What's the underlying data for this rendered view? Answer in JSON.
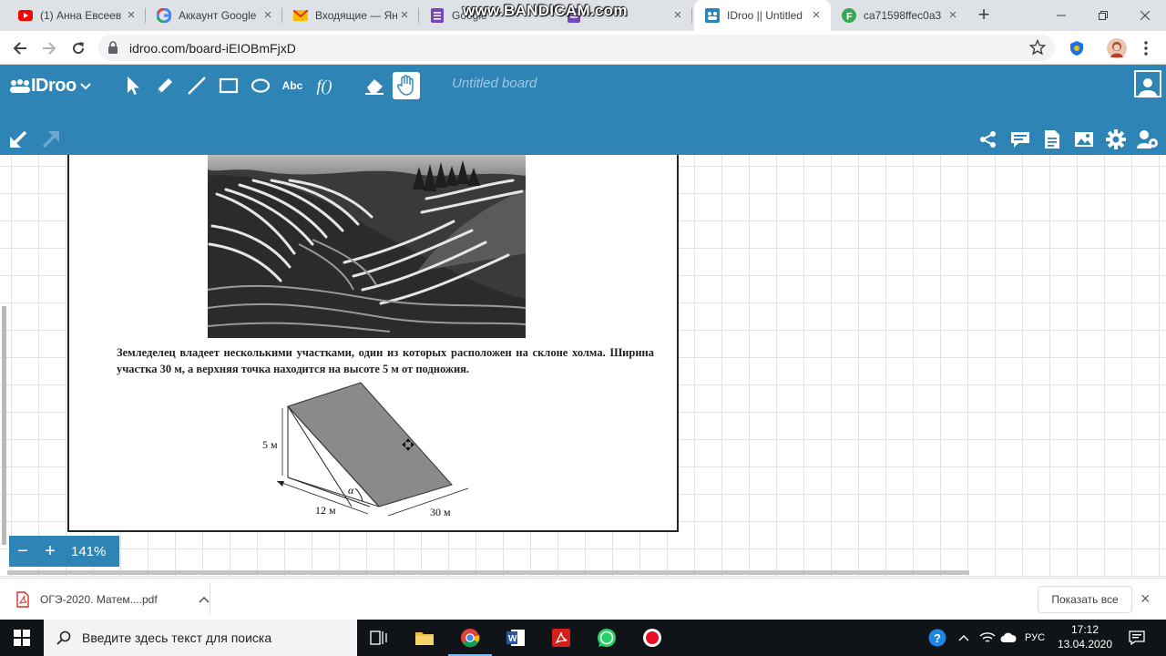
{
  "browser": {
    "tabs": [
      {
        "title": "(1) Анна Евсеев",
        "icon": "youtube-icon"
      },
      {
        "title": "Аккаунт Google",
        "icon": "google-icon"
      },
      {
        "title": "Входящие — Яндекс",
        "icon": "gmail-icon"
      },
      {
        "title": "Google",
        "icon": "google-forms-icon"
      },
      {
        "title": "",
        "icon": "forms-icon"
      },
      {
        "title": "IDroo || Untitled",
        "icon": "idroo-icon",
        "active": true
      },
      {
        "title": "ca71598ffec0a3",
        "icon": "f-icon"
      }
    ],
    "watermark": "www.BANDICAM.com",
    "url": "idroo.com/board-iEIOBmFjxD"
  },
  "idroo": {
    "brand": "IDroo",
    "tool_text_label": "Abc",
    "tool_formula_label": "f()",
    "board_title": "Untitled board",
    "accent": "#2e84b5"
  },
  "sheet": {
    "problem_text": "Земледелец владеет несколькими участками, один из которых расположен на склоне холма. Ширина участка 30 м, а верхняя точка находится на высоте 5 м от подножия.",
    "diagram": {
      "height_label": "5 м",
      "base_label": "12 м",
      "angle_label": "α",
      "width_label": "30 м"
    }
  },
  "zoom": {
    "minus": "−",
    "plus": "+",
    "value": "141%"
  },
  "downloads": {
    "file_name": "ОГЭ-2020. Матем....pdf",
    "show_all": "Показать все"
  },
  "taskbar": {
    "search_placeholder": "Введите здесь текст для поиска",
    "language": "РУС",
    "time": "17:12",
    "date": "13.04.2020"
  }
}
